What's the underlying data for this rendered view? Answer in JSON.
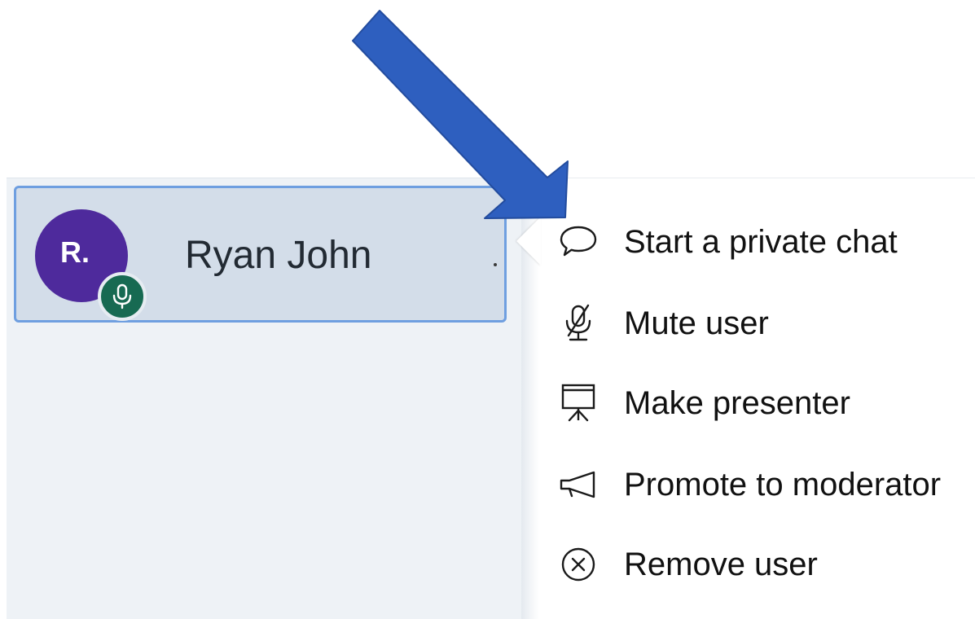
{
  "user": {
    "initials": "R.",
    "name": "Ryan John",
    "avatar_color": "#4e2a9c",
    "voice_badge_color": "#176a52",
    "voice_icon": "microphone-icon"
  },
  "menu": {
    "items": [
      {
        "label": "Start a private chat",
        "icon": "chat-bubble-icon"
      },
      {
        "label": "Mute user",
        "icon": "microphone-muted-icon"
      },
      {
        "label": "Make presenter",
        "icon": "presentation-board-icon"
      },
      {
        "label": "Promote to moderator",
        "icon": "megaphone-icon"
      },
      {
        "label": "Remove user",
        "icon": "close-circle-icon"
      }
    ]
  },
  "annotation": {
    "arrow_color": "#2e5fbf"
  }
}
